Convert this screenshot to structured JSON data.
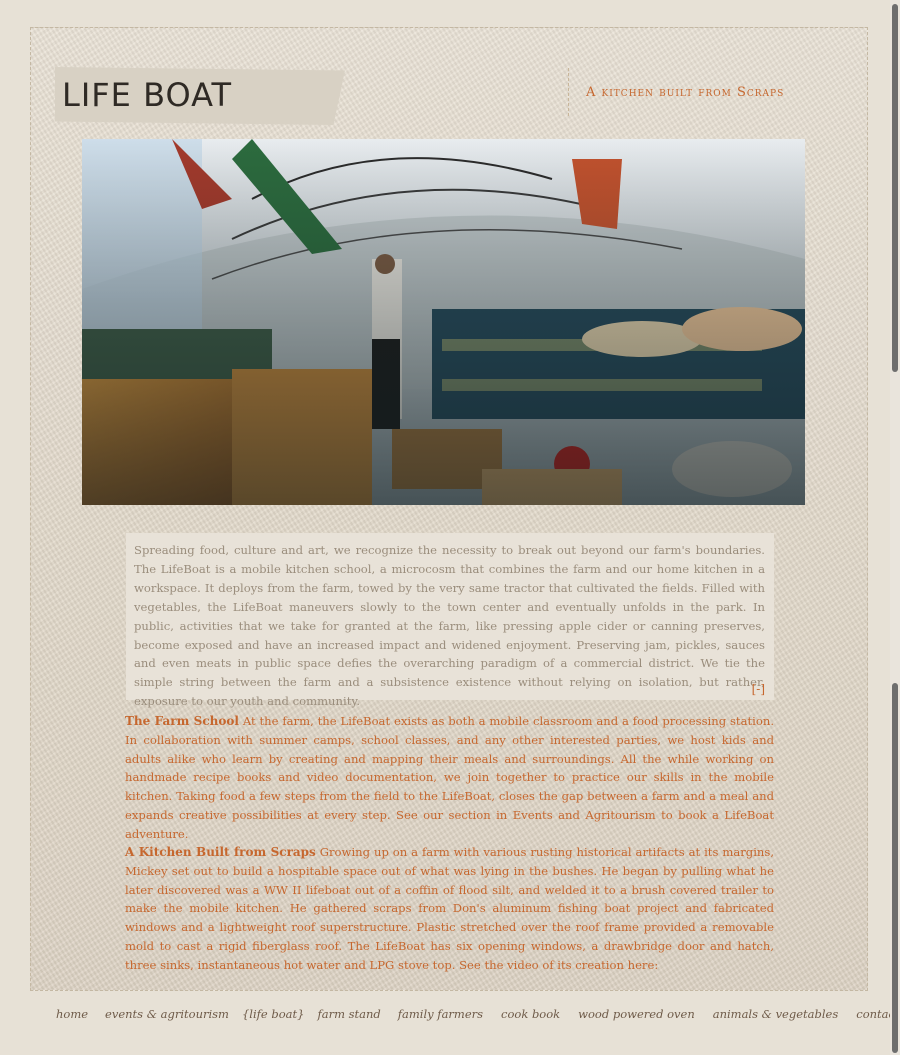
{
  "header": {
    "logo": "LIFE BOAT",
    "tagline": "A kitchen built from Scraps"
  },
  "hero_image": {
    "alt": "Interior of the LifeBoat mobile kitchen workspace"
  },
  "intro": {
    "text": "Spreading food, culture and art, we recognize the necessity to break out beyond our farm's boundaries. The LifeBoat is a mobile kitchen school, a microcosm that combines the farm and our home kitchen in a workspace. It deploys from the farm, towed by the very same tractor that cultivated the fields. Filled with vegetables, the LifeBoat maneuvers slowly to the town center and eventually unfolds in the park. In public, activities that we take for granted at the farm, like pressing apple cider or canning preserves, become exposed and have an increased impact and widened enjoyment. Preserving jam, pickles, sauces and even meats in public space defies the overarching paradigm of a commercial district. We tie the simple string between the farm and a subsistence existence without relying on isolation, but rather, exposure to our youth and community.",
    "toggle": "[-]"
  },
  "sections": [
    {
      "heading": "The Farm School",
      "body": "At the farm, the LifeBoat exists as both a mobile classroom and a food processing station. In collaboration with summer camps, school classes, and any other interested parties, we host kids and adults alike who learn by creating and mapping their meals and surroundings. All the while working on handmade recipe books and video documentation, we join together to practice our skills in the mobile kitchen. Taking food a few steps from the field to the LifeBoat, closes the gap between a farm and a meal and expands creative possibilities at every step. See our section in Events and Agritourism to book a LifeBoat adventure."
    },
    {
      "heading": "A Kitchen Built from Scraps",
      "body": "Growing up on a farm with various rusting historical artifacts at its margins, Mickey set out to build a hospitable space out of what was lying in the bushes. He began by pulling what he later discovered was a WW II lifeboat out of a coffin of flood silt, and welded it to a brush covered trailer to make the mobile kitchen. He gathered scraps from Don's aluminum fishing boat project and fabricated windows and a lightweight roof superstructure. Plastic stretched over the roof frame provided a removable mold to cast a rigid fiberglass roof. The LifeBoat has six opening windows, a drawbridge door and hatch, three sinks, instantaneous hot water and LPG stove top. See the video of its creation here:"
    }
  ],
  "footer_nav": [
    "home",
    "events & agritourism",
    "{life boat}",
    "farm stand",
    "family farmers",
    "cook book",
    "wood powered oven",
    "animals & vegetables",
    "contact us"
  ],
  "colors": {
    "accent": "#c6672e",
    "muted_text": "#9a8d7c",
    "nav_text": "#6e5a48",
    "background": "#e7e1d6"
  }
}
